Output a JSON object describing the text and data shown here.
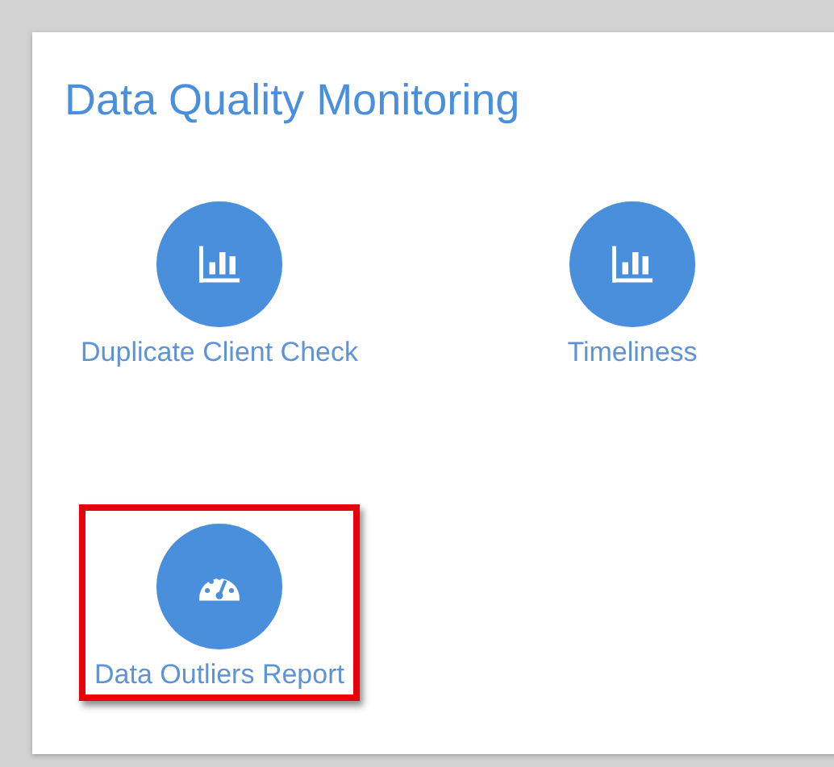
{
  "panel": {
    "title": "Data Quality Monitoring"
  },
  "tiles": [
    {
      "label": "Duplicate Client Check",
      "kind": "chart",
      "highlighted": false
    },
    {
      "label": "Timeliness",
      "kind": "chart",
      "highlighted": false
    },
    {
      "label": "Data Outliers Report",
      "kind": "gauge",
      "highlighted": true
    }
  ]
}
